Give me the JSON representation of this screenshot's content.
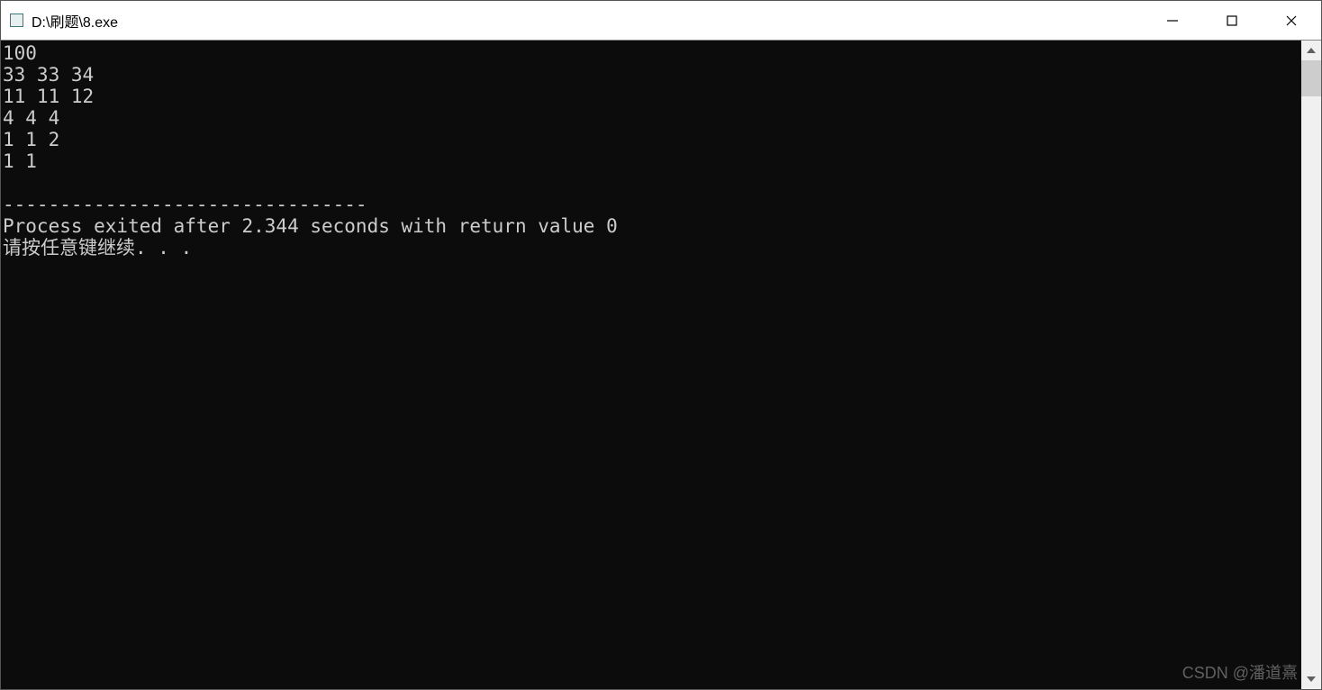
{
  "window": {
    "title": "D:\\刷题\\8.exe"
  },
  "console": {
    "lines": [
      "100",
      "33 33 34",
      "11 11 12",
      "4 4 4",
      "1 1 2",
      "1 1",
      "",
      "--------------------------------",
      "Process exited after 2.344 seconds with return value 0",
      "请按任意键继续. . .",
      ""
    ]
  },
  "watermark": "CSDN @潘道熹"
}
